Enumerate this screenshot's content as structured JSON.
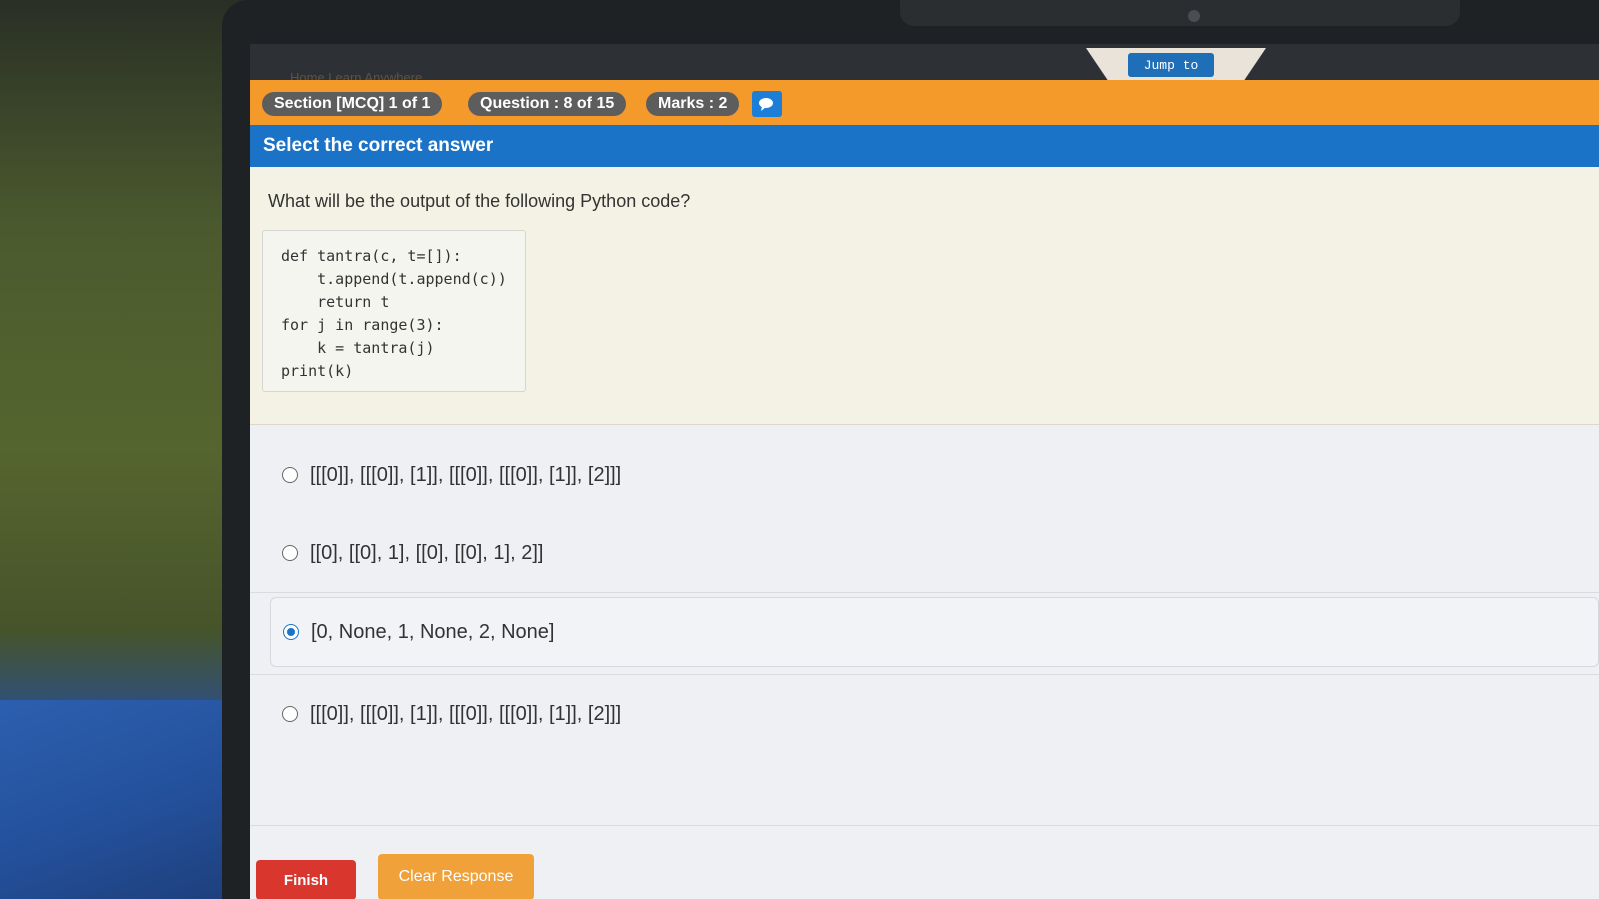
{
  "nav": {
    "ghost_text": "Home   Learn Anywhere",
    "jump_label": "Jump to"
  },
  "info_bar": {
    "section": "Section [MCQ] 1 of 1",
    "question": "Question : 8 of 15",
    "marks": "Marks : 2",
    "chat_icon": "chat-icon"
  },
  "instruction": "Select the correct answer",
  "question": {
    "text": "What will be the output of the following Python code?",
    "code_lines": [
      "def tantra(c, t=[]):",
      "    t.append(t.append(c))",
      "    return t",
      "for j in range(3):",
      "    k = tantra(j)",
      "print(k)"
    ]
  },
  "options": [
    {
      "label": "[[[0]], [[[0]], [1]], [[[0]], [[[0]], [1]], [2]]]",
      "selected": false
    },
    {
      "label": "[[0], [[0], 1], [[0], [[0], 1], 2]]",
      "selected": false
    },
    {
      "label": "[0, None, 1, None, 2, None]",
      "selected": true
    },
    {
      "label": "[[[0]], [[[0]], [1]], [[[0]], [[[0]], [1]], [2]]]",
      "selected": false
    }
  ],
  "buttons": {
    "finish": "Finish",
    "clear": "Clear Response"
  },
  "colors": {
    "orange_bar": "#f39a2b",
    "blue_bar": "#1b73c8",
    "pill": "#5d5d5d",
    "finish": "#d9362e",
    "clear": "#f0a13a"
  }
}
